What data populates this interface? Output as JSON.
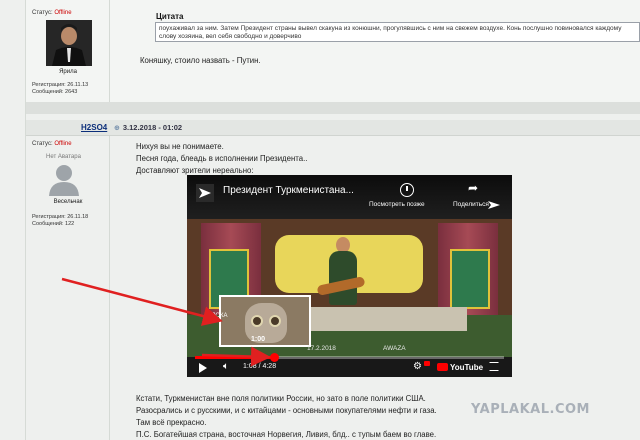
{
  "post_top": {
    "status_label": "Статус:",
    "status_value": "Offline",
    "author_name": "Ярила",
    "reg_label": "Регистрация:",
    "reg_date": "26.11.13",
    "msgs_label": "Сообщений:",
    "msgs_count": "2643",
    "quote_title": "Цитата",
    "quote_text": "поухаживал за ним. Затем Президент страны вывел скакуна из конюшни, прогулявшись с ним на свежем воздухе. Конь послушно повиновался каждому слову хозяина, вел себя свободно и доверчиво",
    "reply_text": "Коняшку, стоило назвать - Путин."
  },
  "post_main": {
    "username": "H2SO4",
    "date": "3.12.2018 - 01:02",
    "status_label": "Статус:",
    "status_value": "Offline",
    "avatar_caption": "Нет Аватара",
    "rank": "Весельчак",
    "reg_label": "Регистрация:",
    "reg_date": "26.11.18",
    "msgs_label": "Сообщений:",
    "msgs_count": "122",
    "lines_before": [
      "Нихуя вы не понимаете.",
      "Песня года, блеадь в исполнении Президента..",
      "Доставляют зрители нереально:"
    ],
    "lines_after": [
      "Кстати, Туркменистан вне поля политики России, но зато в поле политики США.",
      "Разосрались и с русскими, и с китайцами - основными покупателями нефти и газа.",
      "Там всё прекрасно.",
      "П.С. Богатейшая страна, восточная Норвегия, Ливия, блд.. с тупым баем во главе."
    ]
  },
  "video": {
    "title": "Президент Туркменистана...",
    "watch_later": "Посмотреть позже",
    "share": "Поделиться",
    "preview_time": "1:00",
    "watermark_date": "17.2.2018",
    "watermark_channel": "AWAZA",
    "time": "1:08 / 4:28",
    "youtube_label": "YouTube",
    "progress": 0.255,
    "preview_label": "ПОКА"
  },
  "site_brand": "YAPLAKAL.COM",
  "colors": {
    "offline": "#cc0000",
    "username": "#0b2e7a",
    "arrow": "#e02020",
    "progress": "#ff0000"
  }
}
